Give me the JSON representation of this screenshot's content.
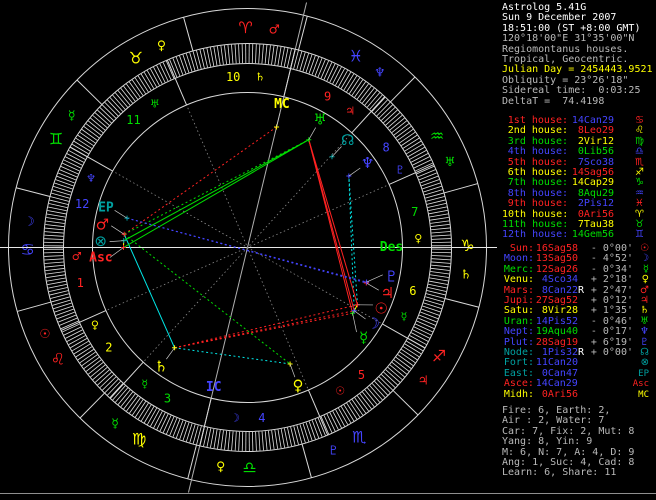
{
  "colors": {
    "white": "#ffffff",
    "gray": "#b9b9b9",
    "dimgray": "#8a8a8a",
    "yellow": "#ffff00",
    "red": "#ff2222",
    "green": "#00dd00",
    "blue": "#4444ff",
    "teal": "#00a0a0",
    "cyan": "#00e8e8",
    "line": "#d9d9d9",
    "axis": "#e8e8e8"
  },
  "info": {
    "lines": [
      {
        "text": "Astrolog 5.41G",
        "color": "white"
      },
      {
        "text": "Sun 9 December 2007",
        "color": "white"
      },
      {
        "text": "18:51:00 (ST +8:00 GMT)",
        "color": "white"
      },
      {
        "text": "120°18'00\"E 31°35'00\"N",
        "color": "gray"
      },
      {
        "text": "Regiomontanus houses.",
        "color": "gray"
      },
      {
        "text": "Tropical, Geocentric.",
        "color": "gray"
      },
      {
        "text": "Julian Day = 2454443.9521",
        "color": "yellow"
      },
      {
        "text": "Obliquity = 23°26'18\"",
        "color": "gray"
      },
      {
        "text": "Sidereal time:  0:03:25",
        "color": "gray"
      },
      {
        "text": "DeltaT =  74.4198",
        "color": "gray"
      }
    ]
  },
  "houses": {
    "rows": [
      {
        "label": "1st house:",
        "value": "14Can29",
        "glyph": "♋",
        "lc": "red",
        "vc": "blue",
        "gc": "red",
        "cusp": 104.483
      },
      {
        "label": "2nd house:",
        "value": "8Leo29",
        "glyph": "♌",
        "lc": "yellow",
        "vc": "red",
        "gc": "yellow",
        "cusp": 128.483
      },
      {
        "label": "3rd house:",
        "value": "2Vir12",
        "glyph": "♍",
        "lc": "green",
        "vc": "yellow",
        "gc": "green",
        "cusp": 152.2
      },
      {
        "label": "4th house:",
        "value": "0Lib56",
        "glyph": "♎",
        "lc": "blue",
        "vc": "green",
        "gc": "blue",
        "cusp": 180.933
      },
      {
        "label": "5th house:",
        "value": "7Sco38",
        "glyph": "♏",
        "lc": "red",
        "vc": "blue",
        "gc": "red",
        "cusp": 217.633
      },
      {
        "label": "6th house:",
        "value": "14Sag56",
        "glyph": "♐",
        "lc": "yellow",
        "vc": "red",
        "gc": "yellow",
        "cusp": 254.933
      },
      {
        "label": "7th house:",
        "value": "14Cap29",
        "glyph": "♑",
        "lc": "green",
        "vc": "yellow",
        "gc": "green",
        "cusp": 284.483
      },
      {
        "label": "8th house:",
        "value": "8Aqu29",
        "glyph": "♒",
        "lc": "blue",
        "vc": "green",
        "gc": "blue",
        "cusp": 308.483
      },
      {
        "label": "9th house:",
        "value": "2Pis12",
        "glyph": "♓",
        "lc": "red",
        "vc": "blue",
        "gc": "red",
        "cusp": 332.2
      },
      {
        "label": "10th house:",
        "value": "0Ari56",
        "glyph": "♈",
        "lc": "yellow",
        "vc": "red",
        "gc": "yellow",
        "cusp": 0.933
      },
      {
        "label": "11th house:",
        "value": "7Tau38",
        "glyph": "♉",
        "lc": "green",
        "vc": "yellow",
        "gc": "green",
        "cusp": 37.633
      },
      {
        "label": "12th house:",
        "value": "14Gem56",
        "glyph": "♊",
        "lc": "blue",
        "vc": "green",
        "gc": "blue",
        "cusp": 74.933
      }
    ]
  },
  "objects": {
    "rows": [
      {
        "label": "Sun:",
        "value": "16Sag58",
        "retro": "",
        "vel": "- 0°00'",
        "glyph": "☉",
        "lc": "red",
        "vc": "red",
        "gc": "red",
        "lon": 256.967
      },
      {
        "label": "Moon:",
        "value": "13Sag50",
        "retro": "",
        "vel": "- 4°52'",
        "glyph": "☽",
        "lc": "blue",
        "vc": "red",
        "gc": "blue",
        "lon": 253.833
      },
      {
        "label": "Merc:",
        "value": "12Sag26",
        "retro": "",
        "vel": "- 0°34'",
        "glyph": "☿",
        "lc": "green",
        "vc": "red",
        "gc": "green",
        "lon": 252.433
      },
      {
        "label": "Venu:",
        "value": "4Sco34",
        "retro": "",
        "vel": "+ 2°18'",
        "glyph": "♀",
        "lc": "yellow",
        "vc": "blue",
        "gc": "yellow",
        "lon": 214.567
      },
      {
        "label": "Mars:",
        "value": "8Can22",
        "retro": "R",
        "vel": "+ 2°47'",
        "glyph": "♂",
        "lc": "red",
        "vc": "blue",
        "gc": "red",
        "lon": 98.367
      },
      {
        "label": "Jupi:",
        "value": "27Sag52",
        "retro": "",
        "vel": "+ 0°12'",
        "glyph": "♃",
        "lc": "red",
        "vc": "red",
        "gc": "red",
        "lon": 267.867
      },
      {
        "label": "Satu:",
        "value": "8Vir28",
        "retro": "",
        "vel": "+ 1°35'",
        "glyph": "♄",
        "lc": "yellow",
        "vc": "yellow",
        "gc": "yellow",
        "lon": 158.467
      },
      {
        "label": "Uran:",
        "value": "14Pis52",
        "retro": "",
        "vel": "- 0°46'",
        "glyph": "♅",
        "lc": "green",
        "vc": "blue",
        "gc": "green",
        "lon": 344.867
      },
      {
        "label": "Nept:",
        "value": "19Aqu40",
        "retro": "",
        "vel": "- 0°17'",
        "glyph": "♆",
        "lc": "blue",
        "vc": "green",
        "gc": "blue",
        "lon": 319.667
      },
      {
        "label": "Plut:",
        "value": "28Sag19",
        "retro": "",
        "vel": "+ 6°19'",
        "glyph": "♇",
        "lc": "blue",
        "vc": "red",
        "gc": "blue",
        "lon": 268.317
      },
      {
        "label": "Node:",
        "value": "1Pis32",
        "retro": "R",
        "vel": "+ 0°00'",
        "glyph": "☊",
        "lc": "teal",
        "vc": "blue",
        "gc": "teal",
        "lon": 331.533
      },
      {
        "label": "Fort:",
        "value": "11Can20",
        "retro": "",
        "vel": "",
        "glyph": "⊗",
        "lc": "teal",
        "vc": "blue",
        "gc": "teal",
        "lon": 101.333
      },
      {
        "label": "East:",
        "value": "0Can47",
        "retro": "",
        "vel": "",
        "glyph": "EP",
        "lc": "teal",
        "vc": "blue",
        "gc": "teal",
        "lon": 90.783
      },
      {
        "label": "Asce:",
        "value": "14Can29",
        "retro": "",
        "vel": "",
        "glyph": "Asc",
        "lc": "red",
        "vc": "blue",
        "gc": "red",
        "lon": 104.483
      },
      {
        "label": "Midh:",
        "value": "0Ari56",
        "retro": "",
        "vel": "",
        "glyph": "MC",
        "lc": "yellow",
        "vc": "red",
        "gc": "yellow",
        "lon": 0.933
      }
    ]
  },
  "stats": {
    "lines": [
      "Fire: 6, Earth: 2,",
      "Air : 2, Water: 7",
      "Car: 7, Fix: 2, Mut: 8",
      "Yang: 8, Yin: 9",
      "M: 6, N: 7, A: 4, D: 9",
      "Ang: 1, Suc: 4, Cad: 8",
      "Learn: 6, Share: 11"
    ]
  },
  "wheel": {
    "ascendant": 104.483,
    "signs": [
      {
        "name": "aries",
        "glyph": "♈",
        "color": "red",
        "ruler": "♂",
        "ruler_color": "red"
      },
      {
        "name": "taurus",
        "glyph": "♉",
        "color": "yellow",
        "ruler": "♀",
        "ruler_color": "yellow"
      },
      {
        "name": "gemini",
        "glyph": "♊",
        "color": "green",
        "ruler": "☿",
        "ruler_color": "green"
      },
      {
        "name": "cancer",
        "glyph": "♋",
        "color": "blue",
        "ruler": "☽",
        "ruler_color": "blue"
      },
      {
        "name": "leo",
        "glyph": "♌",
        "color": "red",
        "ruler": "☉",
        "ruler_color": "red"
      },
      {
        "name": "virgo",
        "glyph": "♍",
        "color": "yellow",
        "ruler": "☿",
        "ruler_color": "green"
      },
      {
        "name": "libra",
        "glyph": "♎",
        "color": "green",
        "ruler": "♀",
        "ruler_color": "yellow"
      },
      {
        "name": "scorpio",
        "glyph": "♏",
        "color": "blue",
        "ruler": "♇",
        "ruler_color": "blue"
      },
      {
        "name": "sagittarius",
        "glyph": "♐",
        "color": "red",
        "ruler": "♃",
        "ruler_color": "red"
      },
      {
        "name": "capricorn",
        "glyph": "♑",
        "color": "yellow",
        "ruler": "♄",
        "ruler_color": "yellow"
      },
      {
        "name": "aquarius",
        "glyph": "♒",
        "color": "green",
        "ruler": "♅",
        "ruler_color": "green"
      },
      {
        "name": "pisces",
        "glyph": "♓",
        "color": "blue",
        "ruler": "♆",
        "ruler_color": "blue"
      }
    ],
    "house_numbers": [
      "1",
      "2",
      "3",
      "4",
      "5",
      "6",
      "7",
      "8",
      "9",
      "10",
      "11",
      "12"
    ],
    "house_number_colors": [
      "red",
      "yellow",
      "green",
      "blue",
      "red",
      "yellow",
      "green",
      "blue",
      "red",
      "yellow",
      "green",
      "blue"
    ],
    "house_rulers": [
      {
        "glyph": "♂",
        "color": "red"
      },
      {
        "glyph": "♀",
        "color": "yellow"
      },
      {
        "glyph": "☿",
        "color": "green"
      },
      {
        "glyph": "☽",
        "color": "blue"
      },
      {
        "glyph": "☉",
        "color": "red"
      },
      {
        "glyph": "☿",
        "color": "green"
      },
      {
        "glyph": "♀",
        "color": "yellow"
      },
      {
        "glyph": "♇",
        "color": "blue"
      },
      {
        "glyph": "♃",
        "color": "red"
      },
      {
        "glyph": "♄",
        "color": "yellow"
      },
      {
        "glyph": "♅",
        "color": "green"
      },
      {
        "glyph": "♆",
        "color": "blue"
      }
    ],
    "axis_labels": [
      {
        "text": "Des",
        "color": "green",
        "lon": 284.483
      },
      {
        "text": "IC",
        "color": "blue",
        "lon": 180.933
      }
    ],
    "aspects": [
      {
        "a": 1,
        "b": 2,
        "t": "con",
        "solid": true
      },
      {
        "a": 0,
        "b": 1,
        "t": "con",
        "solid": true
      },
      {
        "a": 0,
        "b": 2,
        "t": "con",
        "solid": false
      },
      {
        "a": 5,
        "b": 9,
        "t": "con",
        "solid": true
      },
      {
        "a": 11,
        "b": 13,
        "t": "con",
        "solid": true
      },
      {
        "a": 4,
        "b": 6,
        "t": "sex",
        "solid": true
      },
      {
        "a": 3,
        "b": 6,
        "t": "sex",
        "solid": false
      },
      {
        "a": 0,
        "b": 8,
        "t": "sex",
        "solid": false
      },
      {
        "a": 1,
        "b": 8,
        "t": "sex",
        "solid": false
      },
      {
        "a": 0,
        "b": 7,
        "t": "squ",
        "solid": true
      },
      {
        "a": 1,
        "b": 7,
        "t": "squ",
        "solid": true
      },
      {
        "a": 2,
        "b": 7,
        "t": "squ",
        "solid": true
      },
      {
        "a": 6,
        "b": 2,
        "t": "squ",
        "solid": false
      },
      {
        "a": 6,
        "b": 1,
        "t": "squ",
        "solid": false
      },
      {
        "a": 6,
        "b": 0,
        "t": "squ",
        "solid": false
      },
      {
        "a": 14,
        "b": 4,
        "t": "squ",
        "solid": false
      },
      {
        "a": 13,
        "b": 7,
        "t": "tri",
        "solid": true
      },
      {
        "a": 11,
        "b": 7,
        "t": "tri",
        "solid": true
      },
      {
        "a": 4,
        "b": 7,
        "t": "tri",
        "solid": false
      },
      {
        "a": 4,
        "b": 3,
        "t": "tri",
        "solid": false
      },
      {
        "a": 12,
        "b": 9,
        "t": "opp",
        "solid": false
      },
      {
        "a": 12,
        "b": 5,
        "t": "opp",
        "solid": false
      }
    ]
  }
}
